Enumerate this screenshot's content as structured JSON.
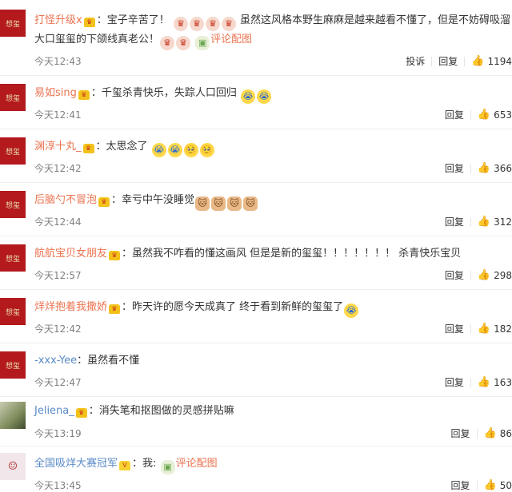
{
  "comments": [
    {
      "username": "打怪升级x",
      "content_lines": [
        "宝子辛苦了！",
        "虽然这风格本野生麻麻是越来越看不懂了，但是不妨碍吸溜",
        "大口玺玺的下颌线真老公！"
      ],
      "link_text": "评论配图",
      "time": "今天12:43",
      "report_label": "投诉",
      "reply_label": "回复",
      "likes": "1194"
    },
    {
      "username": "易如sing",
      "content": "千玺杀青快乐，失踪人口回归",
      "time": "今天12:41",
      "reply_label": "回复",
      "likes": "653"
    },
    {
      "username": "渊淳十丸_",
      "content": "太思念了",
      "time": "今天12:42",
      "reply_label": "回复",
      "likes": "366"
    },
    {
      "username": "后脑勺不冒泡",
      "content": "幸亏中午没睡觉",
      "time": "今天12:44",
      "reply_label": "回复",
      "likes": "312"
    },
    {
      "username": "航航宝贝女朋友",
      "content": "虽然我不咋看的懂这画风 但是是新的玺玺！！！！！！！ 杀青快乐宝贝",
      "time": "今天12:57",
      "reply_label": "回复",
      "likes": "298"
    },
    {
      "username": "烊烊抱着我撒娇",
      "content": "昨天许的愿今天成真了 终于看到新鲜的玺玺了",
      "time": "今天12:42",
      "reply_label": "回复",
      "likes": "182"
    },
    {
      "username": "-xxx-Yee",
      "content": "虽然看不懂",
      "time": "今天12:47",
      "reply_label": "回复",
      "likes": "163"
    },
    {
      "username": "Jeliena_",
      "content": "消失笔和抠图做的灵感拼贴嘛",
      "time": "今天13:19",
      "reply_label": "回复",
      "likes": "86"
    },
    {
      "username": "全国吸烊大赛冠军",
      "content": "我:",
      "link_text": "评论配图",
      "time": "今天13:45",
      "reply_label": "回复",
      "likes": "50"
    }
  ],
  "avatar_text": "想玺",
  "colors": {
    "username": "#eb7350",
    "meta": "#808080",
    "avatar_red": "#b3191d"
  }
}
